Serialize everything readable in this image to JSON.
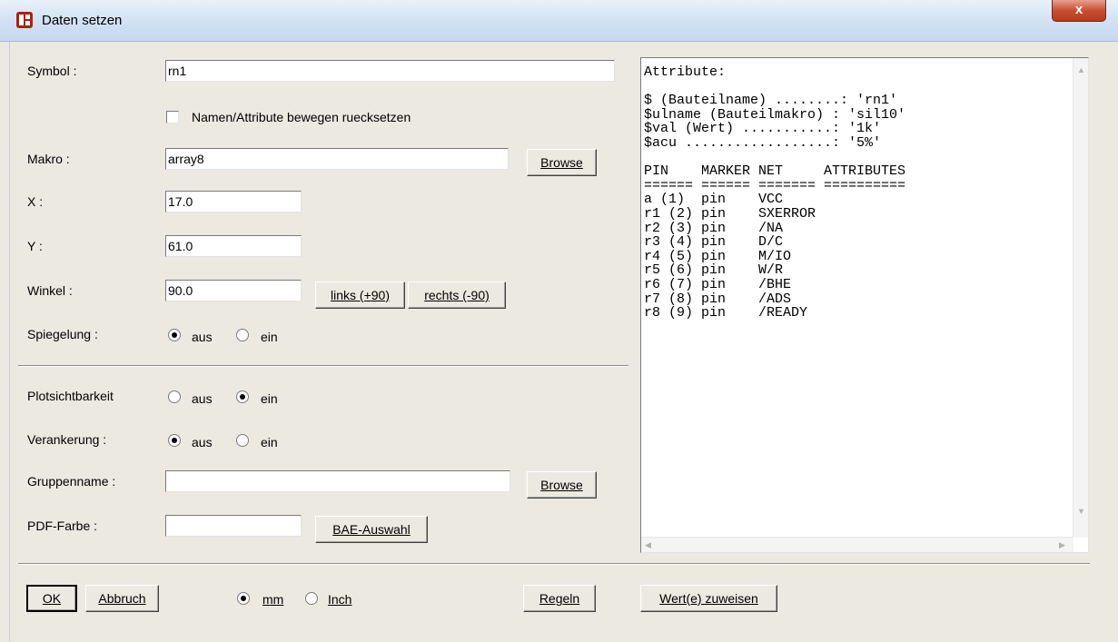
{
  "window": {
    "title": "Daten setzen",
    "close_label": "x"
  },
  "form": {
    "symbol_label": "Symbol :",
    "symbol_value": "rn1",
    "reset_checkbox_label": "Namen/Attribute bewegen ruecksetzen",
    "makro_label": "Makro :",
    "makro_value": "array8",
    "browse_label": "Browse",
    "x_label": "X :",
    "x_value": "17.0",
    "y_label": "Y :",
    "y_value": "61.0",
    "winkel_label": "Winkel :",
    "winkel_value": "90.0",
    "links_label": "links (+90)",
    "rechts_label": "rechts (-90)",
    "spiegelung_label": "Spiegelung :",
    "aus_label": "aus",
    "ein_label": "ein",
    "plotsicht_label": "Plotsichtbarkeit",
    "verankerung_label": "Verankerung :",
    "gruppenname_label": "Gruppenname :",
    "gruppenname_value": "",
    "pdf_farbe_label": "PDF-Farbe :",
    "pdf_farbe_value": "",
    "bae_auswahl_label": "BAE-Auswahl",
    "spiegelung_selected": "aus",
    "plotsicht_selected": "ein",
    "verankerung_selected": "aus"
  },
  "footer": {
    "ok_label": "OK",
    "abbruch_label": "Abbruch",
    "mm_label": "mm",
    "inch_label": "Inch",
    "unit_selected": "mm",
    "regeln_label": "Regeln",
    "zuweisen_label": "Wert(e) zuweisen"
  },
  "attributes_text": "Attribute:\n\n$ (Bauteilname) ........: 'rn1'\n$ulname (Bauteilmakro) : 'sil10'\n$val (Wert) ...........: '1k'\n$acu ..................: '5%'\n\nPIN    MARKER NET     ATTRIBUTES\n====== ====== ======= ==========\na (1)  pin    VCC\nr1 (2) pin    SXERROR\nr2 (3) pin    /NA\nr3 (4) pin    D/C\nr4 (5) pin    M/IO\nr5 (6) pin    W/R\nr6 (7) pin    /BHE\nr7 (8) pin    /ADS\nr8 (9) pin    /READY",
  "colors": {
    "dialog_bg": "#ece9e0",
    "close_button": "#c94f33",
    "titlebar": "#d4e3f4"
  }
}
